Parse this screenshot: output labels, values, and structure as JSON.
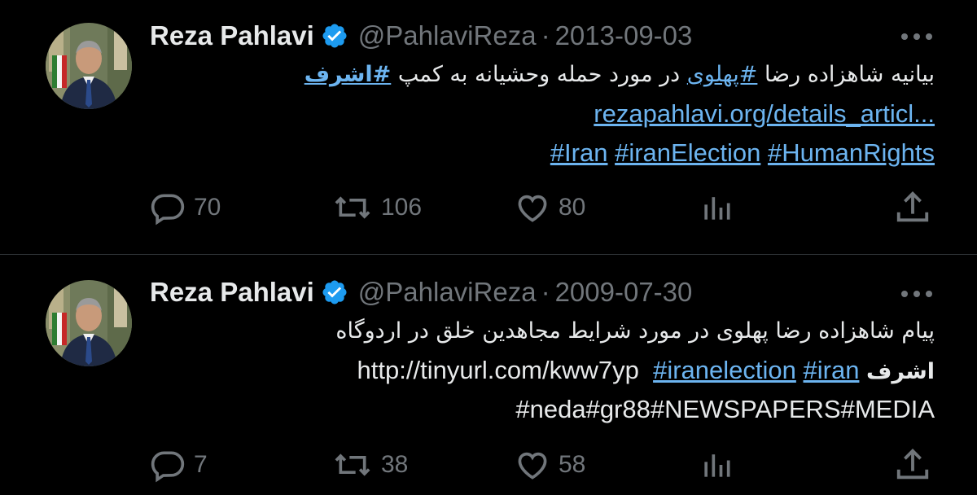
{
  "tweets": [
    {
      "author_name": "Reza Pahlavi",
      "handle": "@PahlaviReza",
      "separator": "·",
      "date": "2013-09-03",
      "text": {
        "line1_before": "بیانیه شاهزاده رضا ",
        "line1_hashtag1": "#پهلوی",
        "line1_middle": " در مورد حمله وحشیانه به کمپ ",
        "line1_hashtag2": "#اشرف",
        "line2_link": "rezapahlavi.org/details_articl...",
        "line3_hashtags": [
          "#Iran",
          "#iranElection",
          "#HumanRights"
        ]
      },
      "actions": {
        "replies": "70",
        "retweets": "106",
        "likes": "80"
      }
    },
    {
      "author_name": "Reza Pahlavi",
      "handle": "@PahlaviReza",
      "separator": "·",
      "date": "2009-07-30",
      "text": {
        "line1": "پیام شاهزاده رضا پهلوی در مورد شرایط مجاهدین خلق در اردوگاه",
        "line2_bold": "اشرف",
        "line2_url": "http://tinyurl.com/kww7yp",
        "line2_hashtags": [
          "#iranelection",
          "#iran"
        ],
        "line3": "#neda#gr88#NEWSPAPERS#MEDIA"
      },
      "actions": {
        "replies": "7",
        "retweets": "38",
        "likes": "58"
      }
    }
  ],
  "colors": {
    "background": "#000000",
    "text": "#e7e9ea",
    "secondary": "#71767b",
    "link": "#6cb4f0",
    "verified": "#1d9bf0",
    "divider": "#2f3336"
  },
  "icons": [
    "avatar-photo",
    "verified-badge-icon",
    "more-icon",
    "reply-icon",
    "retweet-icon",
    "like-icon",
    "views-icon",
    "share-icon"
  ]
}
